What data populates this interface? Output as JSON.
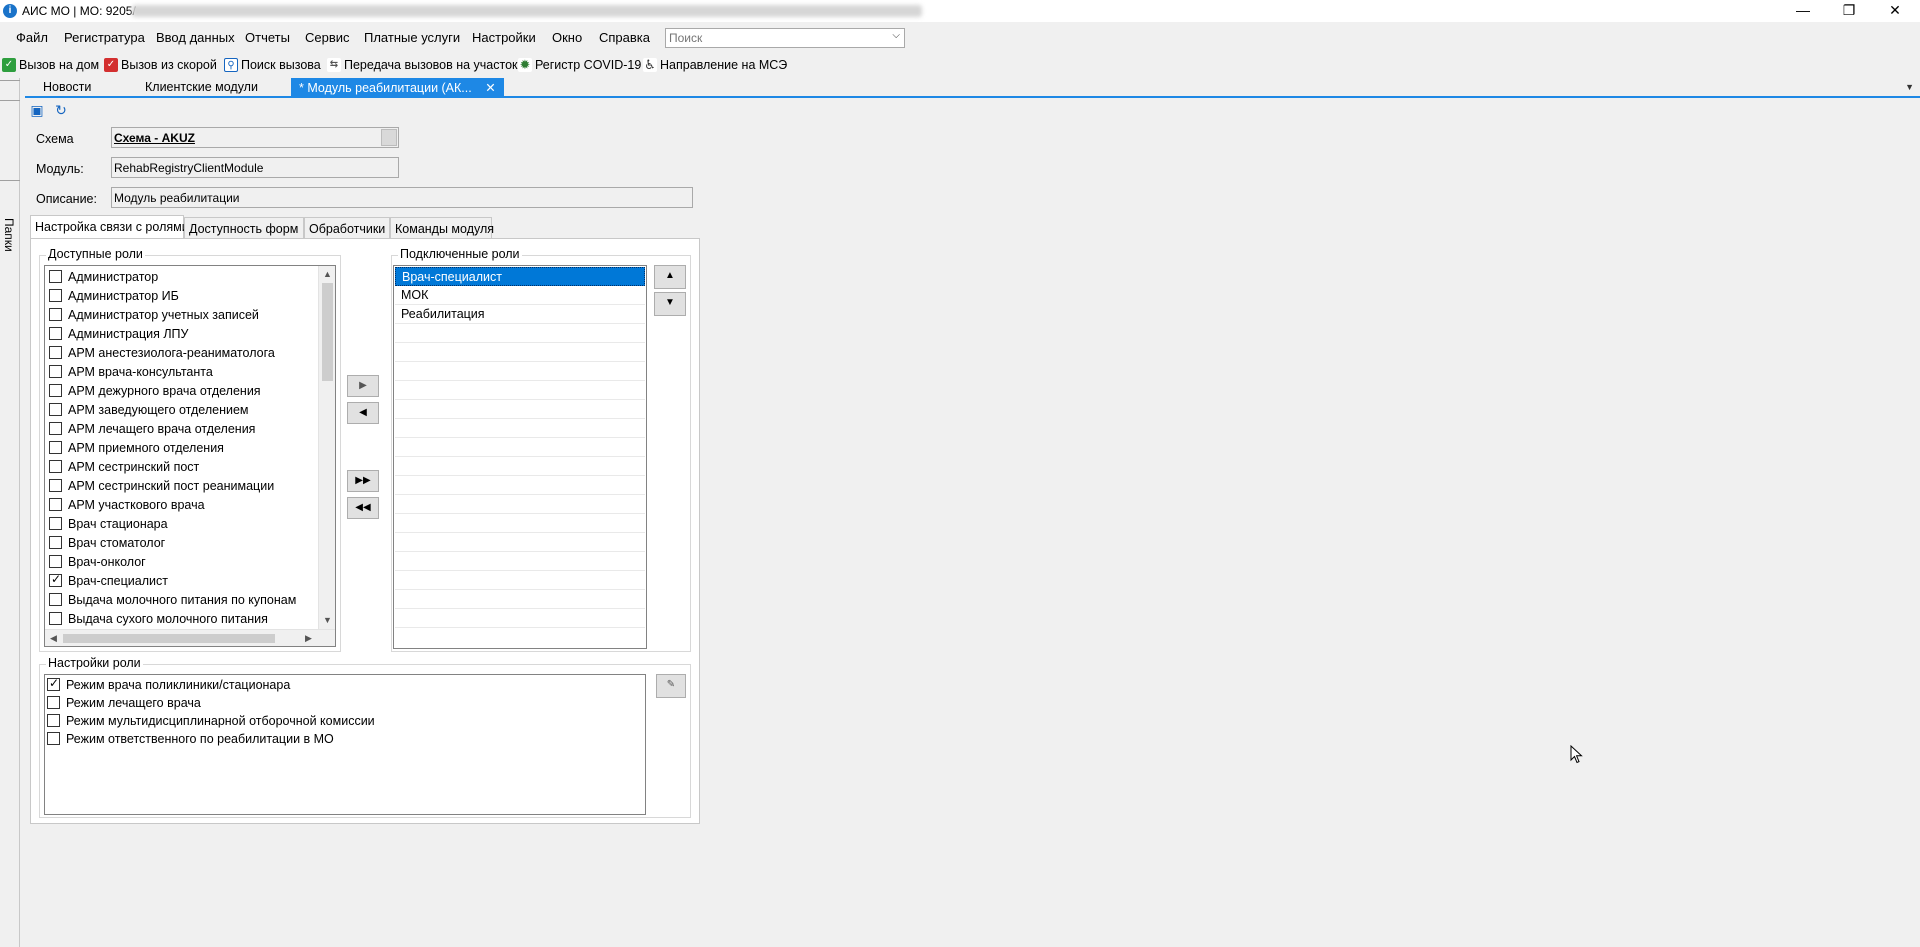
{
  "window": {
    "title": "АИС МО | МО: 9205/"
  },
  "menu": {
    "items": [
      "Файл",
      "Регистратура",
      "Ввод данных",
      "Отчеты",
      "Сервис",
      "Платные услуги",
      "Настройки",
      "Окно",
      "Справка"
    ]
  },
  "search": {
    "placeholder": "Поиск"
  },
  "toolbar": {
    "items": [
      "Вызов на дом",
      "Вызов из скорой",
      "Поиск вызова",
      "Передача вызовов на участок",
      "Регистр COVID-19",
      "Направление на МСЭ"
    ]
  },
  "doc_tabs": {
    "items": [
      "Новости",
      "Клиентские модули",
      "* Модуль реабилитации (АК..."
    ],
    "close": "✕"
  },
  "side": {
    "label": "Папки"
  },
  "form": {
    "schema_label": "Схема",
    "schema_value": "Схема - AKUZ",
    "module_label": "Модуль:",
    "module_value": "RehabRegistryClientModule",
    "description_label": "Описание:",
    "description_value": "Модуль реабилитации"
  },
  "inner_tabs": {
    "items": [
      "Настройка связи с ролями",
      "Доступность форм",
      "Обработчики",
      "Команды модуля"
    ]
  },
  "available_roles": {
    "title": "Доступные роли",
    "items": [
      {
        "label": "Администратор",
        "checked": false
      },
      {
        "label": "Администратор ИБ",
        "checked": false
      },
      {
        "label": "Администратор учетных записей",
        "checked": false
      },
      {
        "label": "Администрация ЛПУ",
        "checked": false
      },
      {
        "label": "АРМ анестезиолога-реаниматолога",
        "checked": false
      },
      {
        "label": "АРМ врача-консультанта",
        "checked": false
      },
      {
        "label": "АРМ дежурного врача отделения",
        "checked": false
      },
      {
        "label": "АРМ заведующего отделением",
        "checked": false
      },
      {
        "label": "АРМ лечащего врача отделения",
        "checked": false
      },
      {
        "label": "АРМ приемного отделения",
        "checked": false
      },
      {
        "label": "АРМ сестринский пост",
        "checked": false
      },
      {
        "label": "АРМ сестринский пост реанимации",
        "checked": false
      },
      {
        "label": "АРМ участкового врача",
        "checked": false
      },
      {
        "label": "Врач стационара",
        "checked": false
      },
      {
        "label": "Врач стоматолог",
        "checked": false
      },
      {
        "label": "Врач-онколог",
        "checked": false
      },
      {
        "label": "Врач-специалист",
        "checked": true
      },
      {
        "label": "Выдача молочного питания по купонам",
        "checked": false
      },
      {
        "label": "Выдача сухого молочного питания",
        "checked": false
      }
    ]
  },
  "connected_roles": {
    "title": "Подключенные роли",
    "items": [
      "Врач-специалист",
      "МОК",
      "Реабилитация"
    ],
    "selected_index": 0
  },
  "role_settings": {
    "title": "Настройки роли",
    "items": [
      {
        "label": "Режим врача поликлиники/стационара",
        "checked": true
      },
      {
        "label": "Режим лечащего врача",
        "checked": false
      },
      {
        "label": "Режим мультидисциплинарной отборочной комиссии",
        "checked": false
      },
      {
        "label": "Режим ответственного по реабилитации в МО",
        "checked": false
      }
    ]
  }
}
